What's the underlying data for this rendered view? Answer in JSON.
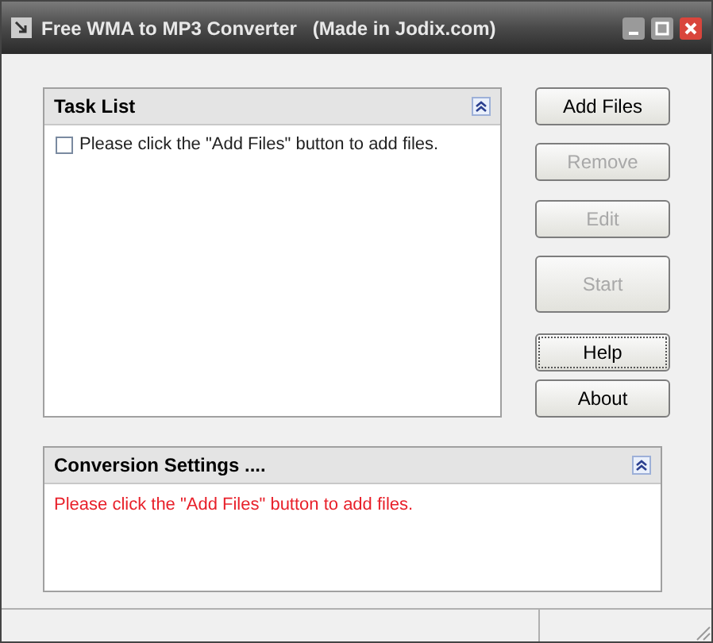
{
  "window": {
    "title": "Free WMA to MP3 Converter   (Made in Jodix.com)"
  },
  "task_list": {
    "title": "Task List",
    "items": [
      {
        "label": "Please click the \"Add Files\" button to add files.",
        "checked": false
      }
    ]
  },
  "buttons": [
    {
      "label": "Add Files",
      "disabled": false,
      "focused": false,
      "kind": "normal"
    },
    {
      "label": "Remove",
      "disabled": true,
      "focused": false,
      "kind": "normal"
    },
    {
      "label": "Edit",
      "disabled": true,
      "focused": false,
      "kind": "normal"
    },
    {
      "label": "Start",
      "disabled": true,
      "focused": false,
      "kind": "tall"
    },
    {
      "label": "Help",
      "disabled": false,
      "focused": true,
      "kind": "normal"
    },
    {
      "label": "About",
      "disabled": false,
      "focused": false,
      "kind": "normal"
    }
  ],
  "conversion_settings": {
    "title": "Conversion Settings ....",
    "message": "Please click the \"Add Files\" button to add files."
  }
}
